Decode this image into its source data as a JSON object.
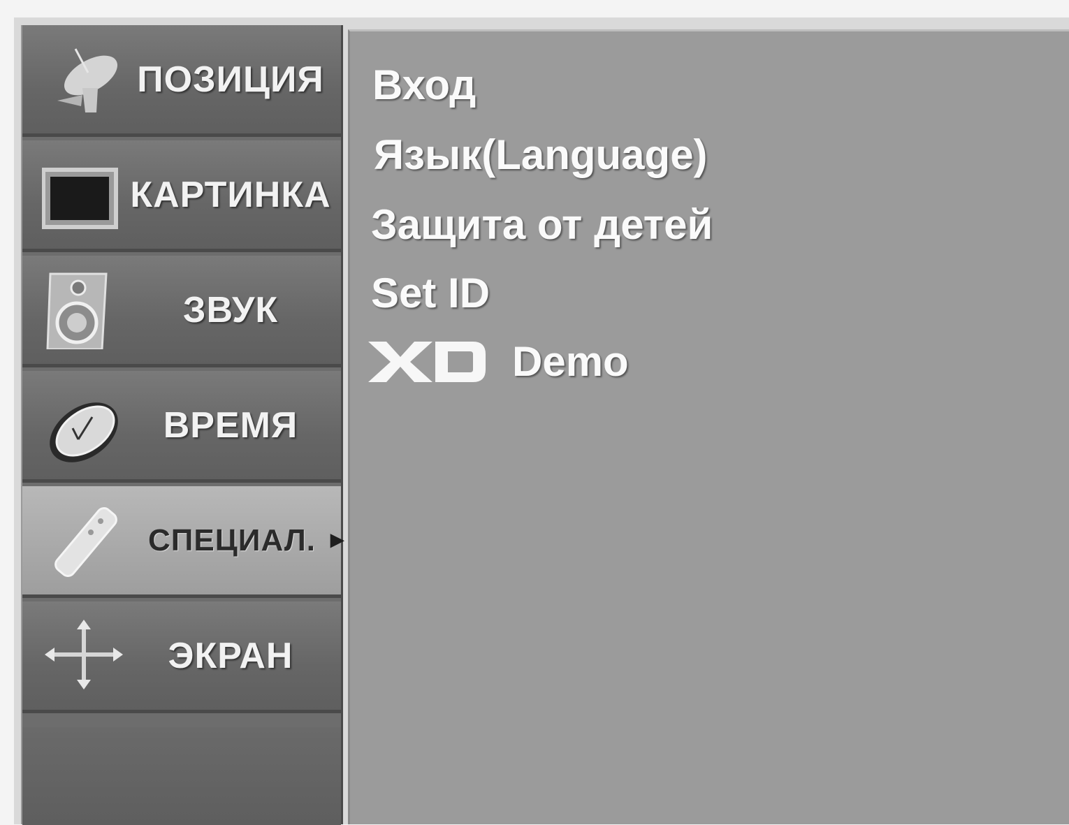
{
  "sidebar": {
    "items": [
      {
        "label": "ПОЗИЦИЯ",
        "icon": "satellite-dish-icon"
      },
      {
        "label": "КАРТИНКА",
        "icon": "tv-screen-icon"
      },
      {
        "label": "ЗВУК",
        "icon": "speaker-icon"
      },
      {
        "label": "ВРЕМЯ",
        "icon": "clock-icon"
      },
      {
        "label": "СПЕЦИАЛ.",
        "icon": "remote-control-icon",
        "active": true,
        "arrow": "►"
      },
      {
        "label": "ЭКРАН",
        "icon": "move-arrows-icon"
      }
    ]
  },
  "panel": {
    "items": [
      {
        "label": "Вход"
      },
      {
        "label": "Язык(Language)"
      },
      {
        "label": "Защита от детей"
      },
      {
        "label": "Set ID"
      },
      {
        "label": "Demo",
        "logo": "XD"
      }
    ]
  }
}
